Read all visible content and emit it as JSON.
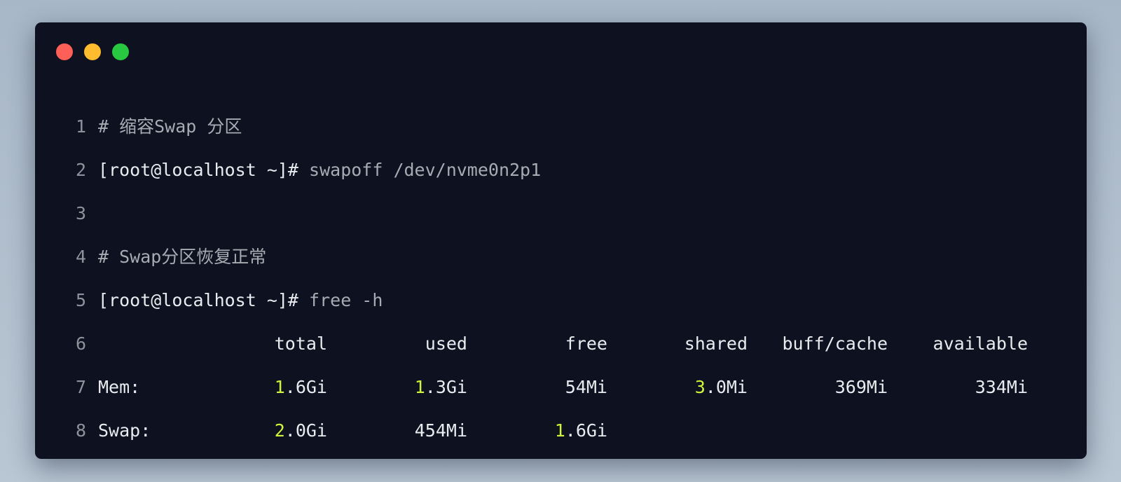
{
  "window": {
    "traffic_lights": [
      {
        "name": "close",
        "color": "#fe5f57"
      },
      {
        "name": "minimize",
        "color": "#febc2e"
      },
      {
        "name": "zoom",
        "color": "#28c840"
      }
    ]
  },
  "colors": {
    "background": "#0d1120",
    "line_number": "#8d929b",
    "comment": "#a7abb2",
    "text": "#e9ebef",
    "number_highlight": "#d2f33c"
  },
  "lines": [
    {
      "number": "1",
      "comment": "# 缩容Swap 分区"
    },
    {
      "number": "2",
      "prompt": "[root@localhost ~]#",
      "command": " swapoff /dev/nvme0n2p1"
    },
    {
      "number": "3"
    },
    {
      "number": "4",
      "comment": "# Swap分区恢复正常"
    },
    {
      "number": "5",
      "prompt": "[root@localhost ~]#",
      "command": " free -h"
    },
    {
      "number": "6",
      "headers": [
        "total",
        "used",
        "free",
        "shared",
        "buff/cache",
        "available"
      ]
    },
    {
      "number": "7",
      "label": "Mem:",
      "cells": [
        {
          "lead": "1",
          "rest": ".6Gi"
        },
        {
          "lead": "1",
          "rest": ".3Gi"
        },
        {
          "lead": "",
          "rest": "54Mi"
        },
        {
          "lead": "3",
          "rest": ".0Mi"
        },
        {
          "lead": "",
          "rest": "369Mi"
        },
        {
          "lead": "",
          "rest": "334Mi"
        }
      ]
    },
    {
      "number": "8",
      "label": "Swap:",
      "cells": [
        {
          "lead": "2",
          "rest": ".0Gi"
        },
        {
          "lead": "",
          "rest": "454Mi"
        },
        {
          "lead": "1",
          "rest": ".6Gi"
        }
      ]
    }
  ]
}
